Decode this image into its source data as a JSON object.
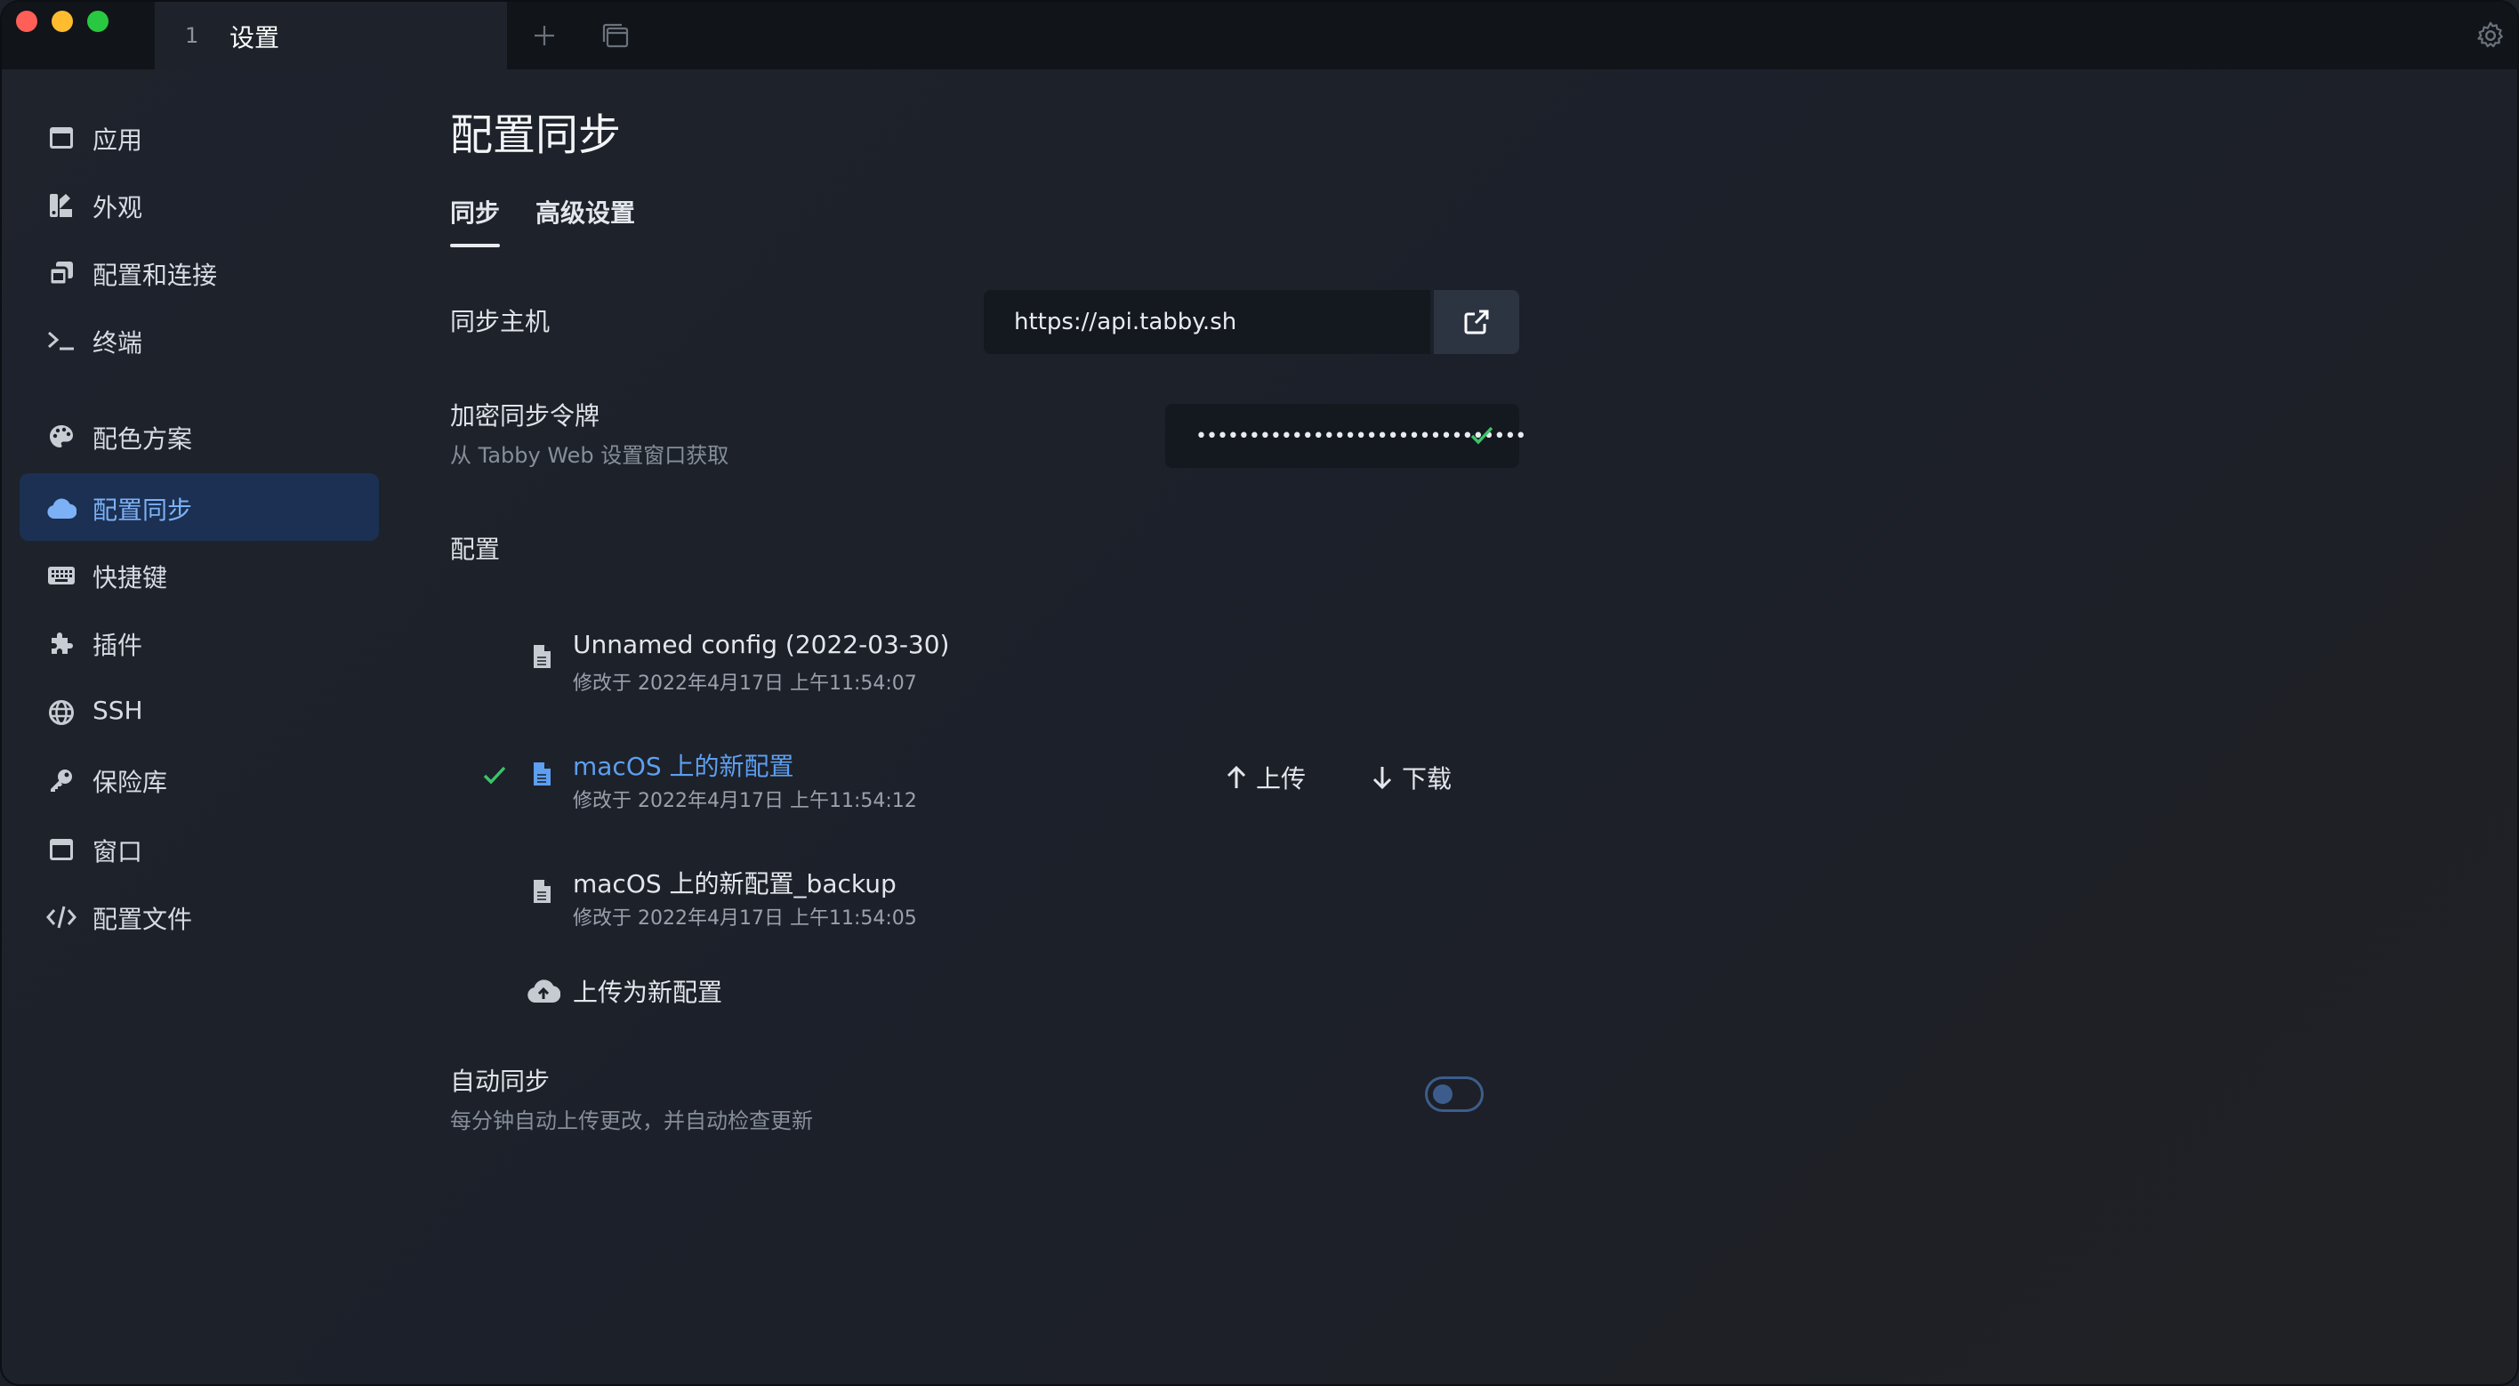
{
  "titlebar": {
    "tab_index": "1",
    "tab_title": "设置"
  },
  "sidebar": {
    "items": [
      {
        "label": "应用",
        "icon": "window-icon"
      },
      {
        "label": "外观",
        "icon": "paint-icon"
      },
      {
        "label": "配置和连接",
        "icon": "profiles-icon"
      },
      {
        "label": "终端",
        "icon": "terminal-icon"
      },
      {
        "label": "配色方案",
        "icon": "palette-icon"
      },
      {
        "label": "配置同步",
        "icon": "cloud-icon",
        "active": true
      },
      {
        "label": "快捷键",
        "icon": "keyboard-icon"
      },
      {
        "label": "插件",
        "icon": "puzzle-icon"
      },
      {
        "label": "SSH",
        "icon": "globe-icon"
      },
      {
        "label": "保险库",
        "icon": "key-icon"
      },
      {
        "label": "窗口",
        "icon": "window-icon"
      },
      {
        "label": "配置文件",
        "icon": "code-icon"
      }
    ]
  },
  "main": {
    "title": "配置同步",
    "tabs": [
      {
        "label": "同步",
        "active": true
      },
      {
        "label": "高级设置"
      }
    ],
    "sync_host": {
      "label": "同步主机",
      "value": "https://api.tabby.sh"
    },
    "token": {
      "label": "加密同步令牌",
      "hint": "从 Tabby Web 设置窗口获取",
      "value": "•••••••••••••••••••••••••••••••"
    },
    "configs_label": "配置",
    "configs": [
      {
        "name": "Unnamed config (2022-03-30)",
        "date": "修改于 2022年4月17日 上午11:54:07",
        "current": false
      },
      {
        "name": "macOS 上的新配置",
        "date": "修改于 2022年4月17日 上午11:54:12",
        "current": true
      },
      {
        "name": "macOS 上的新配置_backup",
        "date": "修改于 2022年4月17日 上午11:54:05",
        "current": false
      }
    ],
    "upload_label": "上传",
    "download_label": "下载",
    "upload_new_label": "上传为新配置",
    "auto_sync": {
      "label": "自动同步",
      "hint": "每分钟自动上传更改，并自动检查更新",
      "enabled": false
    }
  },
  "colors": {
    "accent": "#5d9ff0",
    "active_nav_bg": "#1b3052",
    "success": "#3bc46a",
    "background": "#1b2029"
  }
}
